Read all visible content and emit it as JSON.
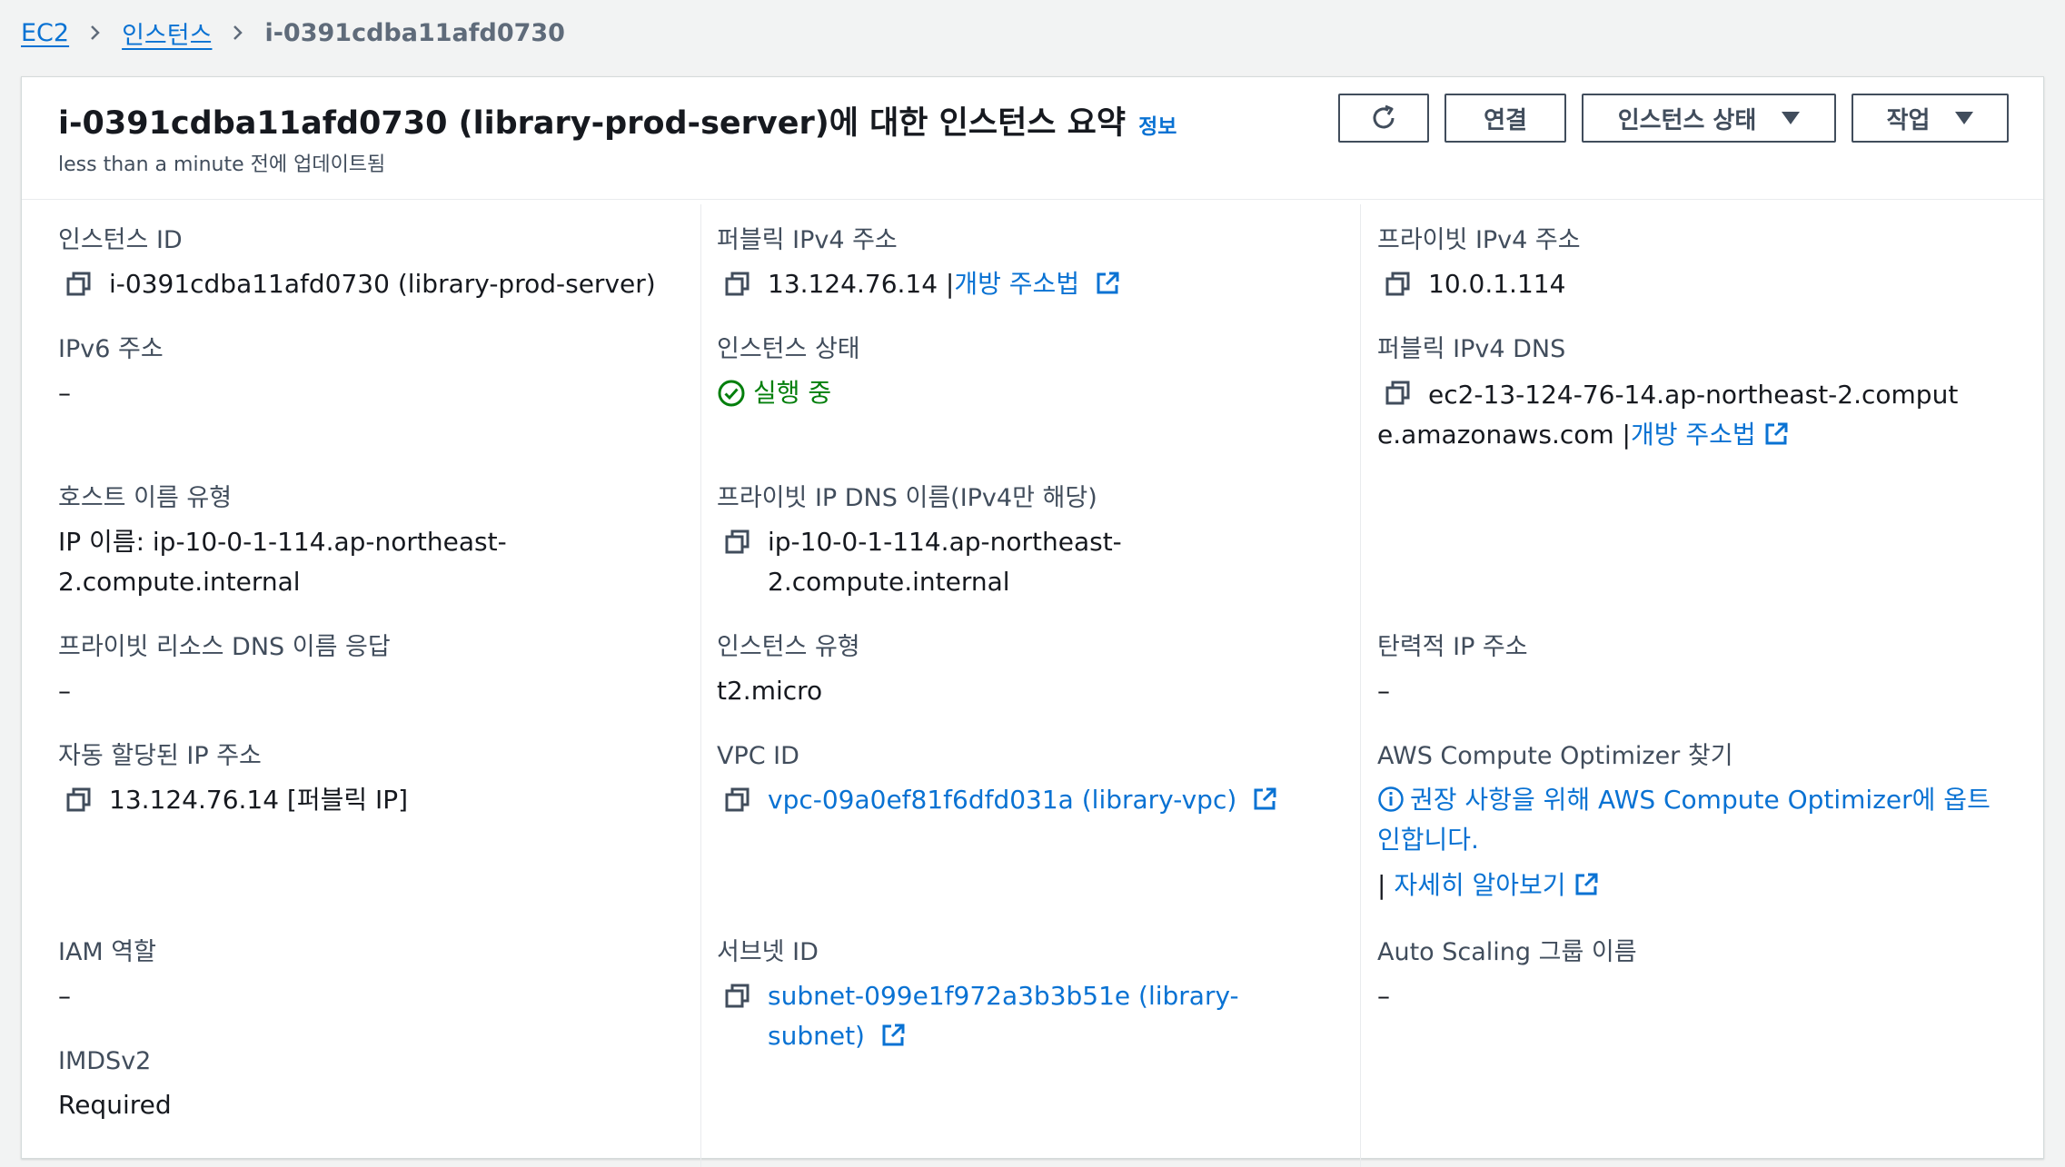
{
  "breadcrumb": {
    "items": [
      "EC2",
      "인스턴스"
    ],
    "current": "i-0391cdba11afd0730"
  },
  "header": {
    "title": "i-0391cdba11afd0730 (library-prod-server)에 대한 인스턴스 요약",
    "info_link": "정보",
    "updated": "less than a minute 전에 업데이트됨",
    "connect_label": "연결",
    "instance_state_label": "인스턴스 상태",
    "actions_label": "작업"
  },
  "fields": {
    "instance_id": {
      "label": "인스턴스 ID",
      "value": "i-0391cdba11afd0730 (library-prod-server)"
    },
    "public_ipv4": {
      "label": "퍼블릭 IPv4 주소",
      "value": "13.124.76.14 |",
      "link": "개방 주소법"
    },
    "private_ipv4": {
      "label": "프라이빗 IPv4 주소",
      "value": "10.0.1.114"
    },
    "ipv6": {
      "label": "IPv6 주소",
      "value": "–"
    },
    "instance_state": {
      "label": "인스턴스 상태",
      "value": "실행 중"
    },
    "public_dns": {
      "label": "퍼블릭 IPv4 DNS",
      "value": "ec2-13-124-76-14.ap-northeast-2.compute.amazonaws.com |",
      "link": "개방 주소법"
    },
    "hostname_type": {
      "label": "호스트 이름 유형",
      "value": "IP 이름: ip-10-0-1-114.ap-northeast-2.compute.internal"
    },
    "private_dns": {
      "label": "프라이빗 IP DNS 이름(IPv4만 해당)",
      "value": "ip-10-0-1-114.ap-northeast-2.compute.internal"
    },
    "resource_dns": {
      "label": "프라이빗 리소스 DNS 이름 응답",
      "value": "–"
    },
    "instance_type": {
      "label": "인스턴스 유형",
      "value": "t2.micro"
    },
    "elastic_ip": {
      "label": "탄력적 IP 주소",
      "value": "–"
    },
    "auto_ip": {
      "label": "자동 할당된 IP 주소",
      "value": "13.124.76.14 [퍼블릭 IP]"
    },
    "vpc_id": {
      "label": "VPC ID",
      "value": "vpc-09a0ef81f6dfd031a (library-vpc)"
    },
    "optimizer": {
      "label": "AWS Compute Optimizer 찾기",
      "value": "권장 사항을 위해 AWS Compute Optimizer에 옵트인합니다.",
      "prefix": "|",
      "link": "자세히 알아보기"
    },
    "iam_role": {
      "label": "IAM 역할",
      "value": "–"
    },
    "subnet_id": {
      "label": "서브넷 ID",
      "value": "subnet-099e1f972a3b3b51e (library-subnet)"
    },
    "asg_name": {
      "label": "Auto Scaling 그룹 이름",
      "value": "–"
    },
    "imdsv2": {
      "label": "IMDSv2",
      "value": "Required"
    }
  },
  "colors": {
    "link": "#0972d3",
    "success": "#037f0c",
    "text": "#16191f",
    "label": "#414d5c"
  },
  "icons": [
    "chevron-right-icon",
    "refresh-icon",
    "caret-down-icon",
    "copy-icon",
    "external-link-icon",
    "status-check-icon",
    "info-icon"
  ]
}
